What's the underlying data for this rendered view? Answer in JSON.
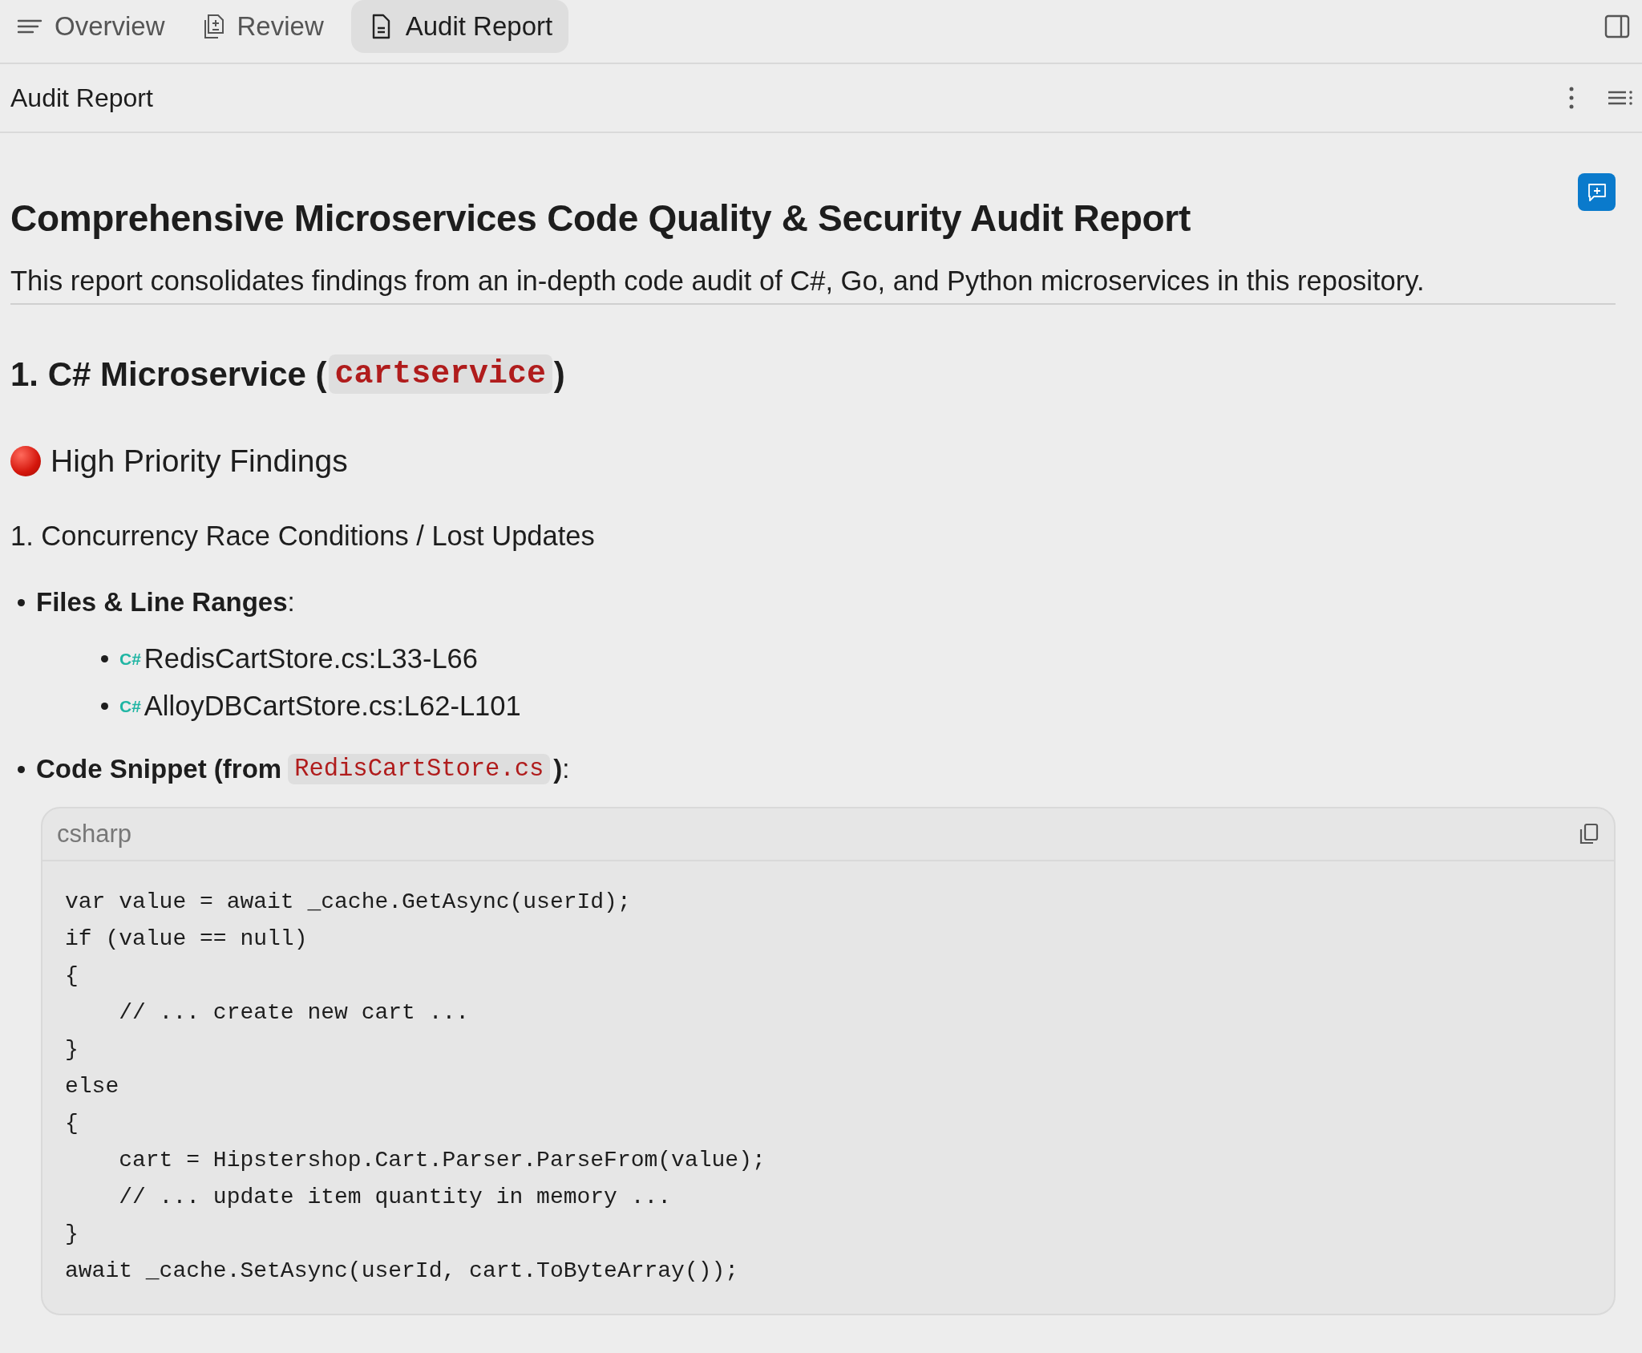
{
  "tabs": [
    {
      "kind": "list",
      "label": "Overview",
      "selected": false
    },
    {
      "kind": "review",
      "label": "Review",
      "selected": false
    },
    {
      "kind": "document",
      "label": "Audit Report",
      "selected": true
    }
  ],
  "header": {
    "title": "Audit Report"
  },
  "report": {
    "title": "Comprehensive Microservices Code Quality & Security Audit Report",
    "intro": "This report consolidates findings from an in-depth code audit of C#, Go, and Python microservices in this repository.",
    "section": {
      "prefix": "1. C# Microservice (",
      "code": "cartservice",
      "suffix": ")"
    },
    "priority": {
      "label": "High Priority Findings"
    },
    "finding": {
      "title": "1. Concurrency Race Conditions / Lost Updates",
      "files_label": "**Files & Line Ranges**:",
      "files": [
        {
          "icon_text": "C#",
          "name": "RedisCartStore.cs:L33-L66"
        },
        {
          "icon_text": "C#",
          "name": "AlloyDBCartStore.cs:L62-L101"
        }
      ],
      "snippet_label": {
        "prefix": "Code Snippet (from",
        "code": "RedisCartStore.cs",
        "suffix": "):"
      },
      "code_block": {
        "language": "csharp",
        "lines": [
          "var value = await _cache.GetAsync(userId);",
          "if (value == null)",
          "{",
          "    // ... create new cart ...",
          "}",
          "else",
          "{",
          "    cart = Hipstershop.Cart.Parser.ParseFrom(value);",
          "    // ... update item quantity in memory ...",
          "}",
          "await _cache.SetAsync(userId, cart.ToByteArray());"
        ]
      }
    }
  }
}
